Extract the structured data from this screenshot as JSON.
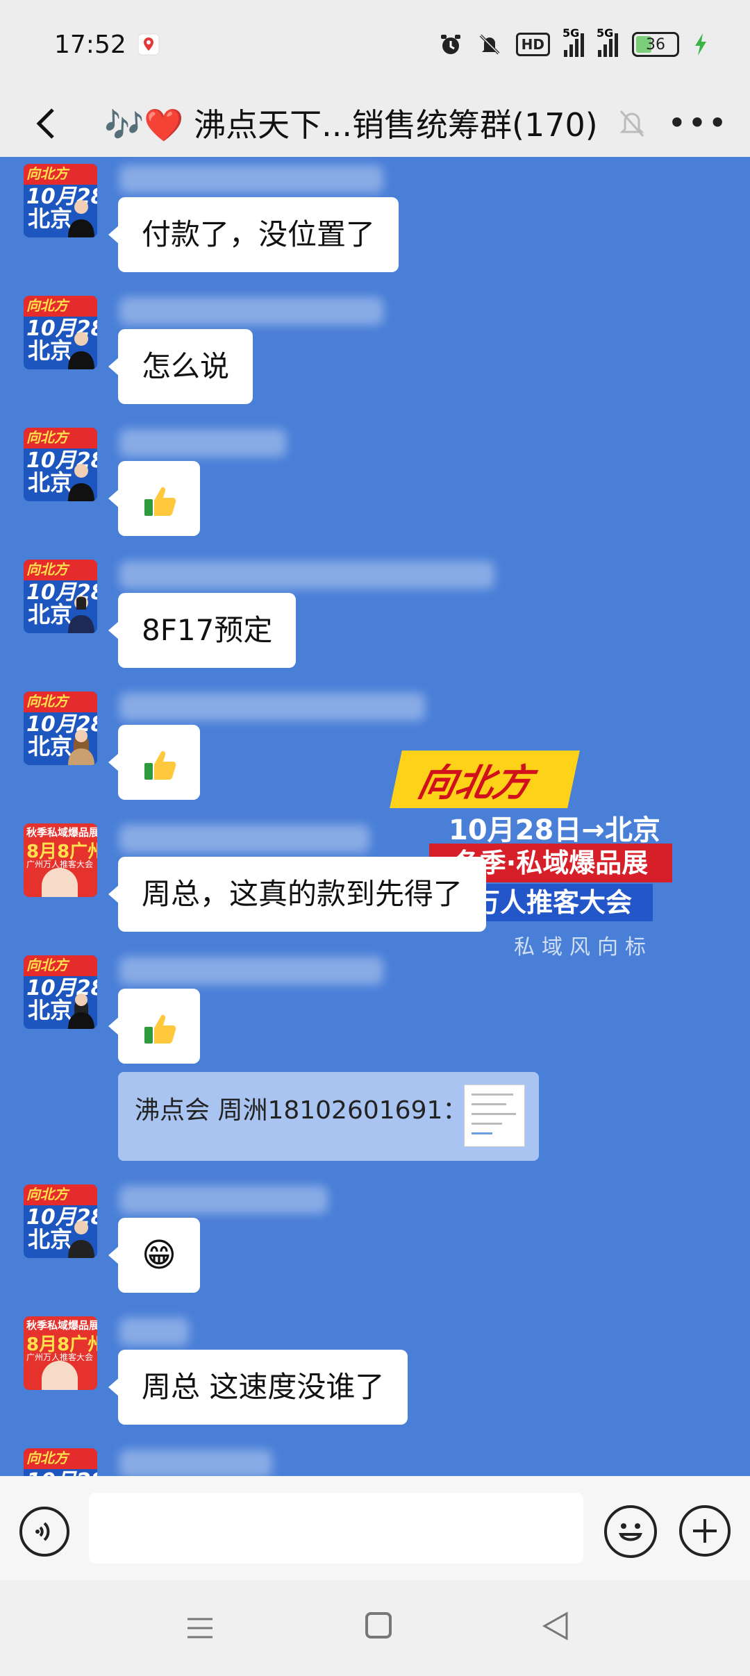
{
  "status_bar": {
    "time": "17:52",
    "hd_label": "HD",
    "signal1_label": "5G",
    "signal2_label": "5G",
    "battery": "36"
  },
  "header": {
    "title": "🎶❤️ 沸点天下...销售统筹群(170)"
  },
  "watermark": {
    "brand": "向北方",
    "date_line": "10月28日→北京",
    "line1": "冬季·私域爆品展",
    "line2": "万人推客大会",
    "line3": "私域风向标"
  },
  "avatars": {
    "beijing": {
      "brand": "向北方",
      "date": "10月28",
      "city": "北京"
    },
    "guangzhou": {
      "top": "秋季私域爆品展",
      "big": "8月8广州",
      "small": "广州万人推客大会"
    }
  },
  "messages": [
    {
      "type": "text",
      "text": "付款了，没位置了"
    },
    {
      "type": "text",
      "text": "怎么说"
    },
    {
      "type": "emoji",
      "emoji": "thumbs-up"
    },
    {
      "type": "text",
      "text": "8F17预定"
    },
    {
      "type": "emoji",
      "emoji": "thumbs-up"
    },
    {
      "type": "text",
      "text": "周总，这真的款到先得了"
    },
    {
      "type": "emoji",
      "emoji": "thumbs-up"
    },
    {
      "type": "quote",
      "text": "沸点会 周洲18102601691："
    },
    {
      "type": "emoji",
      "emoji": "grin",
      "glyph": "😁"
    },
    {
      "type": "text",
      "text": "周总 这速度没谁了"
    }
  ],
  "colors": {
    "chat_background": "#4a7fd8",
    "bubble": "#ffffff",
    "quote": "#a9c4f0"
  }
}
